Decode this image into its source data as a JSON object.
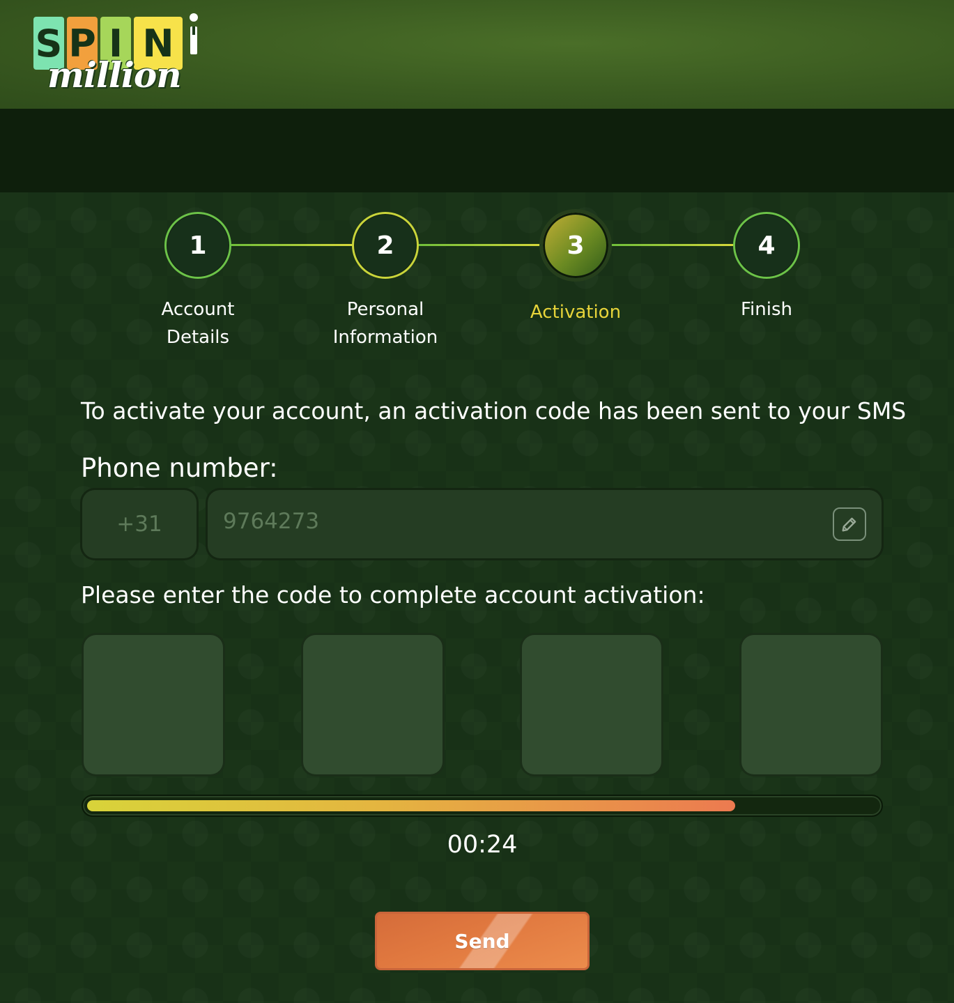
{
  "brand": {
    "logo_letters": [
      "S",
      "P",
      "I",
      "N"
    ],
    "logo_script": "million",
    "logo_colors": [
      "#7de3b0",
      "#f2a03d",
      "#a6d65a",
      "#f7e24a"
    ]
  },
  "stepper": {
    "steps": [
      {
        "number": "1",
        "label_line1": "Account",
        "label_line2": "Details",
        "state": "done"
      },
      {
        "number": "2",
        "label_line1": "Personal",
        "label_line2": "Information",
        "state": "done"
      },
      {
        "number": "3",
        "label_line1": "Activation",
        "label_line2": "",
        "state": "active"
      },
      {
        "number": "4",
        "label_line1": "Finish",
        "label_line2": "",
        "state": "pending"
      }
    ],
    "active_color": "#e7d43a"
  },
  "activation": {
    "info_text": "To activate your account, an activation code has been sent to your SMS",
    "phone_label": "Phone number:",
    "phone_prefix": "+31",
    "phone_number": "9764273",
    "code_label": "Please enter the code to complete account activation:",
    "code_digits": [
      "",
      "",
      "",
      ""
    ],
    "progress_fraction": 0.82,
    "timer": "00:24",
    "send_label": "Send"
  },
  "icons": {
    "edit": "pencil-icon"
  },
  "colors": {
    "header": "#3a5a20",
    "background": "#1a3418",
    "send_button": "#e0783f",
    "progress_start": "#d8d33a",
    "progress_end": "#ec7a50"
  }
}
